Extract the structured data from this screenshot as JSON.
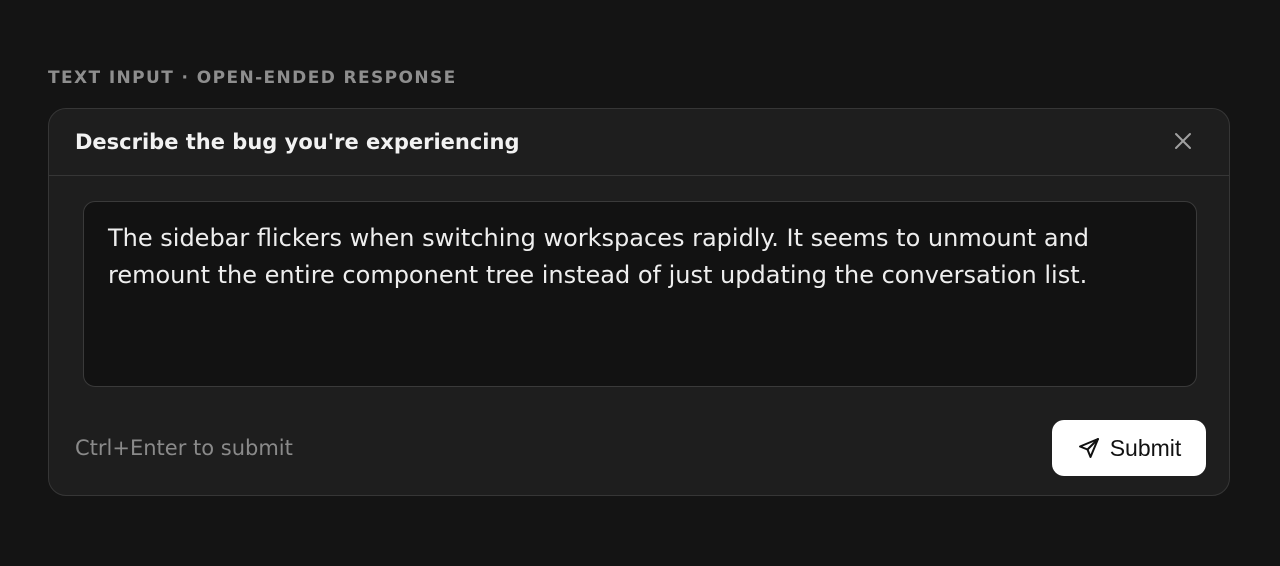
{
  "section_label": "TEXT INPUT · OPEN-ENDED RESPONSE",
  "card": {
    "title": "Describe the bug you're experiencing",
    "close_icon": "close-icon",
    "textarea": {
      "value": "The sidebar flickers when switching workspaces rapidly. It seems to unmount and remount the entire component tree instead of just updating the conversation list."
    },
    "hint": "Ctrl+Enter to submit",
    "submit": {
      "label": "Submit",
      "icon": "send-icon"
    }
  },
  "colors": {
    "background": "#141414",
    "card": "#1e1e1e",
    "border": "#363636",
    "textarea_background": "#121212",
    "button": "#ffffff"
  }
}
